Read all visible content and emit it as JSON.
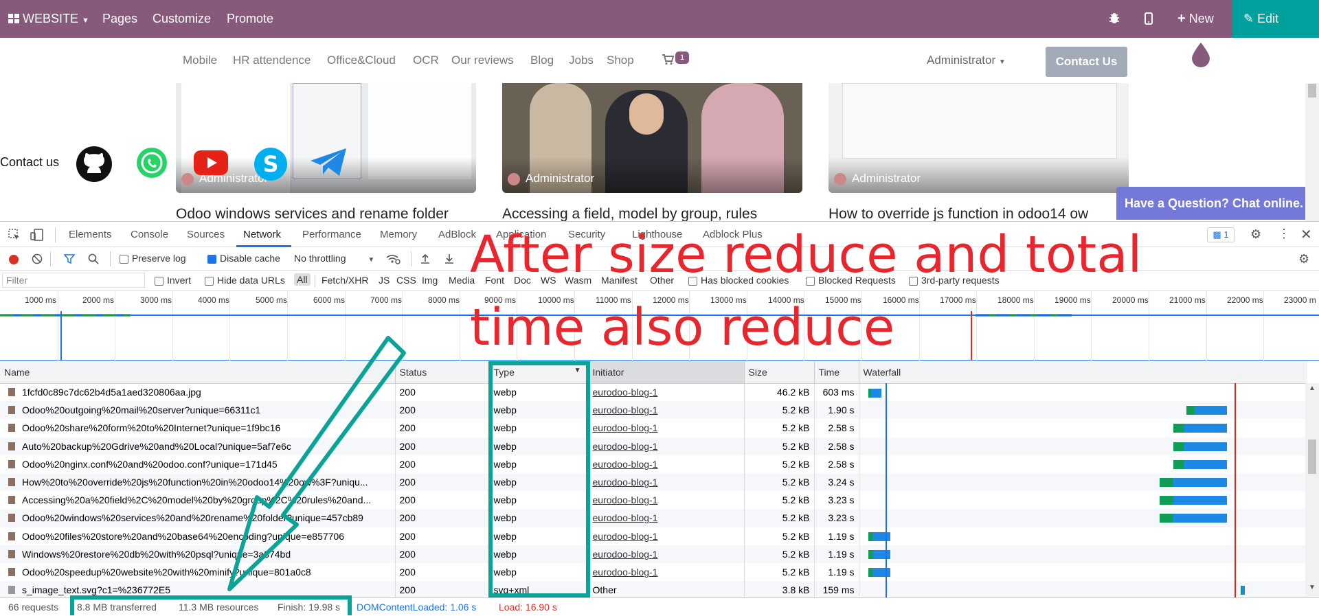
{
  "topbar": {
    "website_label": "WEBSITE",
    "pages_label": "Pages",
    "customize_label": "Customize",
    "promote_label": "Promote",
    "new_label": "New",
    "edit_label": "Edit"
  },
  "sitenav": {
    "links": [
      "Mobile",
      "HR attendence",
      "Office&Cloud",
      "OCR",
      "Our reviews",
      "Blog",
      "Jobs",
      "Shop"
    ],
    "cart_count": "1",
    "user_label": "Administrator",
    "contact_button": "Contact Us"
  },
  "contact_us_label": "Contact us",
  "cards": [
    {
      "author": "Administrator",
      "title": "Odoo windows services and rename folder"
    },
    {
      "author": "Administrator",
      "title": "Accessing a field, model by group, rules"
    },
    {
      "author": "Administrator",
      "title": "How to override js function in odoo14 ow"
    }
  ],
  "chat_online": "Have a Question? Chat online.",
  "devtools": {
    "tabs": [
      "Elements",
      "Console",
      "Sources",
      "Network",
      "Performance",
      "Memory",
      "AdBlock",
      "Application",
      "Security",
      "Lighthouse",
      "Adblock Plus"
    ],
    "active_tab": "Network",
    "messages_count": "1",
    "preserve_log": "Preserve log",
    "disable_cache": "Disable cache",
    "throttling": "No throttling",
    "filter_placeholder": "Filter",
    "invert": "Invert",
    "hide_data_urls": "Hide data URLs",
    "type_filters": [
      "All",
      "Fetch/XHR",
      "JS",
      "CSS",
      "Img",
      "Media",
      "Font",
      "Doc",
      "WS",
      "Wasm",
      "Manifest",
      "Other"
    ],
    "has_blocked_cookies": "Has blocked cookies",
    "blocked_requests": "Blocked Requests",
    "third_party": "3rd-party requests",
    "timeline_ticks": [
      "1000 ms",
      "2000 ms",
      "3000 ms",
      "4000 ms",
      "5000 ms",
      "6000 ms",
      "7000 ms",
      "8000 ms",
      "9000 ms",
      "10000 ms",
      "11000 ms",
      "12000 ms",
      "13000 ms",
      "14000 ms",
      "15000 ms",
      "16000 ms",
      "17000 ms",
      "18000 ms",
      "19000 ms",
      "20000 ms",
      "21000 ms",
      "22000 ms",
      "23000 m"
    ],
    "columns": [
      "Name",
      "Status",
      "Type",
      "Initiator",
      "Size",
      "Time",
      "Waterfall"
    ],
    "rows": [
      {
        "name": "1fcfd0c89c7dc62b4d5a1aed320806aa.jpg",
        "status": "200",
        "type": "webp",
        "initiator": "eurodoo-blog-1",
        "size": "46.2 kB",
        "time": "603 ms",
        "wf": [
          0.02,
          0.05
        ]
      },
      {
        "name": "Odoo%20outgoing%20mail%20server?unique=66311c1",
        "status": "200",
        "type": "webp",
        "initiator": "eurodoo-blog-1",
        "size": "5.2 kB",
        "time": "1.90 s",
        "wf": [
          0.73,
          0.82
        ]
      },
      {
        "name": "Odoo%20share%20form%20to%20Internet?unique=1f9bc16",
        "status": "200",
        "type": "webp",
        "initiator": "eurodoo-blog-1",
        "size": "5.2 kB",
        "time": "2.58 s",
        "wf": [
          0.7,
          0.82
        ]
      },
      {
        "name": "Auto%20backup%20Gdrive%20and%20Local?unique=5af7e6c",
        "status": "200",
        "type": "webp",
        "initiator": "eurodoo-blog-1",
        "size": "5.2 kB",
        "time": "2.58 s",
        "wf": [
          0.7,
          0.82
        ]
      },
      {
        "name": "Odoo%20nginx.conf%20and%20odoo.conf?unique=171d45",
        "status": "200",
        "type": "webp",
        "initiator": "eurodoo-blog-1",
        "size": "5.2 kB",
        "time": "2.58 s",
        "wf": [
          0.7,
          0.82
        ]
      },
      {
        "name": "How%20to%20override%20js%20function%20in%20odoo14%20ow%3F?uniqu...",
        "status": "200",
        "type": "webp",
        "initiator": "eurodoo-blog-1",
        "size": "5.2 kB",
        "time": "3.24 s",
        "wf": [
          0.67,
          0.82
        ]
      },
      {
        "name": "Accessing%20a%20field%2C%20model%20by%20group%2C%20rules%20and...",
        "status": "200",
        "type": "webp",
        "initiator": "eurodoo-blog-1",
        "size": "5.2 kB",
        "time": "3.23 s",
        "wf": [
          0.67,
          0.82
        ]
      },
      {
        "name": "Odoo%20windows%20services%20and%20rename%20folder?unique=457cb89",
        "status": "200",
        "type": "webp",
        "initiator": "eurodoo-blog-1",
        "size": "5.2 kB",
        "time": "3.23 s",
        "wf": [
          0.67,
          0.82
        ]
      },
      {
        "name": "Odoo%20files%20store%20and%20base64%20encoding?unique=e857706",
        "status": "200",
        "type": "webp",
        "initiator": "eurodoo-blog-1",
        "size": "5.2 kB",
        "time": "1.19 s",
        "wf": [
          0.02,
          0.07
        ]
      },
      {
        "name": "Windows%20restore%20db%20with%20psql?unique=3a874bd",
        "status": "200",
        "type": "webp",
        "initiator": "eurodoo-blog-1",
        "size": "5.2 kB",
        "time": "1.19 s",
        "wf": [
          0.02,
          0.07
        ]
      },
      {
        "name": "Odoo%20speedup%20website%20with%20minify?unique=801a0c8",
        "status": "200",
        "type": "webp",
        "initiator": "eurodoo-blog-1",
        "size": "5.2 kB",
        "time": "1.19 s",
        "wf": [
          0.02,
          0.07
        ]
      },
      {
        "name": "s_image_text.svg?c1=%236772E5",
        "status": "200",
        "type": "svg+xml",
        "initiator": "Other",
        "size": "3.8 kB",
        "time": "159 ms",
        "wf": [
          0.85,
          0.86
        ]
      }
    ],
    "status": {
      "requests": "66 requests",
      "transferred": "8.8 MB transferred",
      "resources": "11.3 MB resources",
      "finish": "Finish: 19.98 s",
      "dom_loaded": "DOMContentLoaded: 1.06 s",
      "load": "Load: 16.90 s"
    }
  },
  "annotation": {
    "line1": "After size reduce and total",
    "line2": "time also reduce"
  },
  "colors": {
    "odoo_purple": "#875a7b",
    "teal": "#00a09d",
    "annotation_red": "#e8262d",
    "dom_blue": "#1a73e8",
    "load_red": "#d93025"
  }
}
